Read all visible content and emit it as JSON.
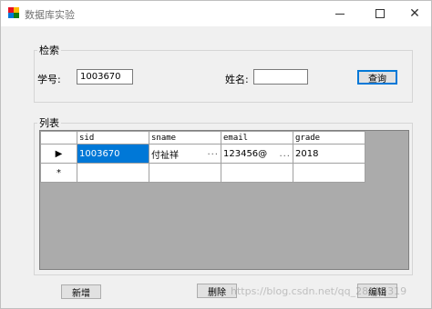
{
  "window": {
    "title": "数据库实验",
    "controls": {
      "minimize_icon": "minimize-icon",
      "maximize_icon": "maximize-icon",
      "close_icon": "close-icon",
      "close_glyph": "✕"
    }
  },
  "search_group": {
    "label": "检索",
    "student_id_label": "学号:",
    "student_id_value": "1003670",
    "name_label": "姓名:",
    "name_value": "",
    "query_button": "查询"
  },
  "list_group": {
    "label": "列表",
    "columns": [
      "sid",
      "sname",
      "email",
      "grade"
    ],
    "rows": [
      {
        "indicator": "▶",
        "sid": "1003670",
        "sname": "付祉祥",
        "email": "123456@",
        "grade": "2018"
      },
      {
        "indicator": "*",
        "sid": "",
        "sname": "",
        "email": "",
        "grade": ""
      }
    ],
    "ellipsis": "..."
  },
  "buttons": {
    "add": "新增",
    "delete": "删除",
    "edit": "编辑"
  },
  "watermark": "https://blog.csdn.net/qq_28115319",
  "colors": {
    "selection": "#0078d7",
    "grid_background": "#ababab",
    "window_bg": "#f0f0f0"
  }
}
